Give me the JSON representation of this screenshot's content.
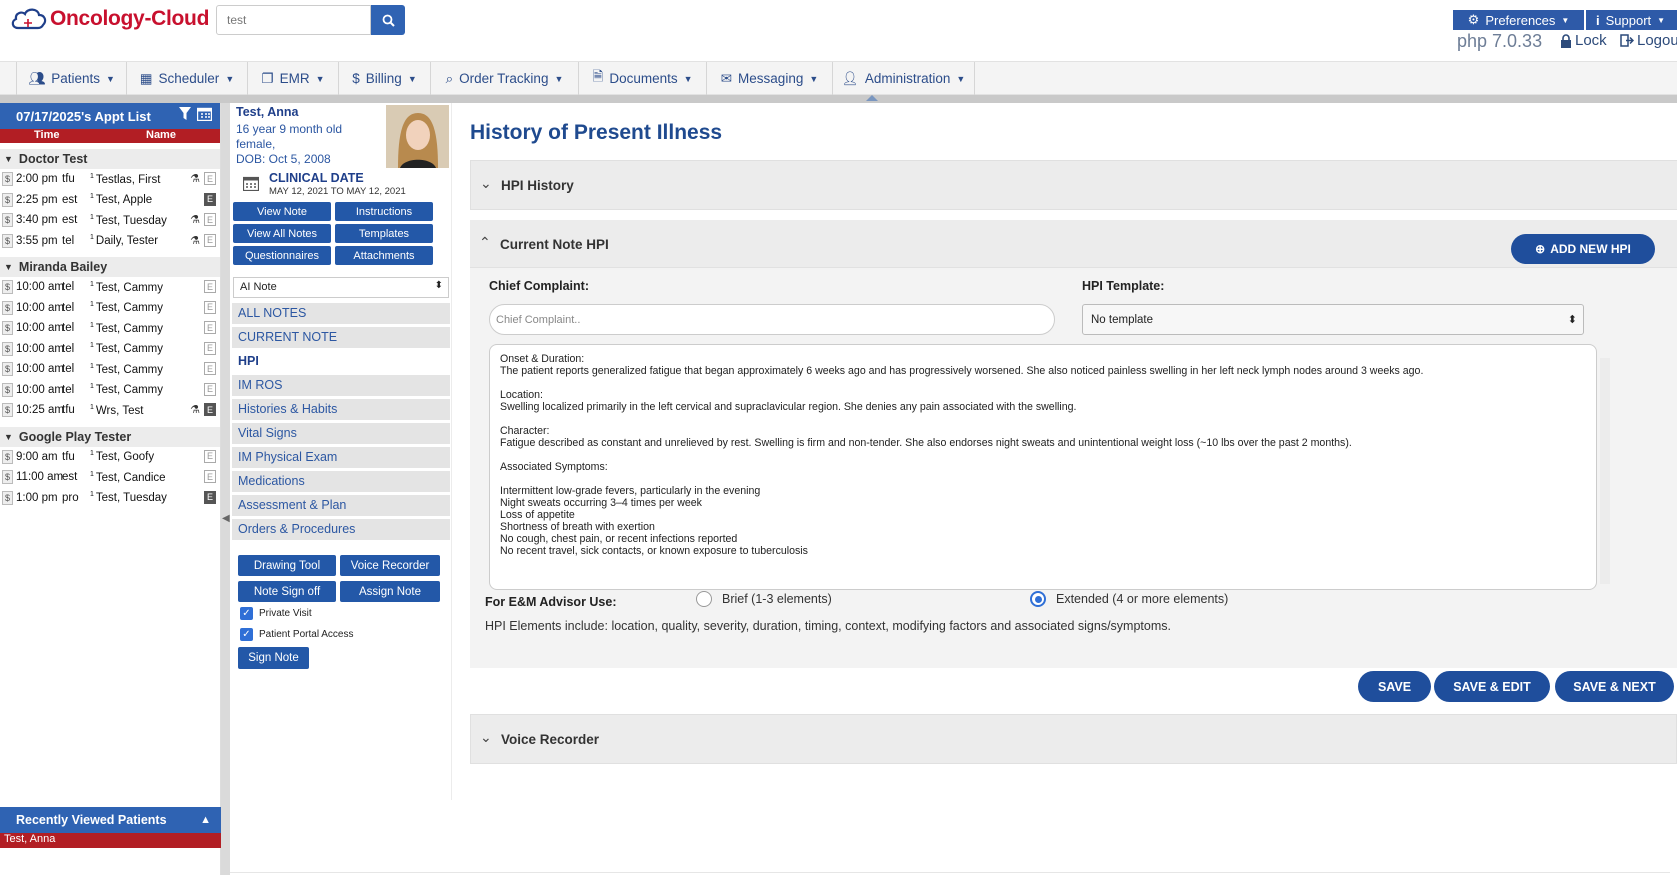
{
  "header": {
    "brand": "Oncology-Cloud",
    "search_value": "test",
    "preferences_label": "Preferences",
    "support_label": "Support",
    "php_version": "php 7.0.33",
    "lock_label": "Lock",
    "logout_label": "Logou"
  },
  "nav": {
    "items": [
      {
        "label": "Patients",
        "icon": "users-icon"
      },
      {
        "label": "Scheduler",
        "icon": "calendar-icon"
      },
      {
        "label": "EMR",
        "icon": "copy-icon"
      },
      {
        "label": "Billing",
        "icon": "dollar-icon"
      },
      {
        "label": "Order Tracking",
        "icon": "search-icon"
      },
      {
        "label": "Documents",
        "icon": "document-icon"
      },
      {
        "label": "Messaging",
        "icon": "envelope-icon"
      },
      {
        "label": "Administration",
        "icon": "user-icon"
      }
    ]
  },
  "appt_list": {
    "title": "07/17/2025's Appt List",
    "col_time": "Time",
    "col_name": "Name",
    "groups": [
      {
        "provider": "Doctor Test",
        "rows": [
          {
            "time": "2:00 pm",
            "type": "tfu",
            "num": "1",
            "name": "Testlas, First"
          },
          {
            "time": "2:25 pm",
            "type": "est",
            "num": "1",
            "name": "Test, Apple"
          },
          {
            "time": "3:40 pm",
            "type": "est",
            "num": "1",
            "name": "Test, Tuesday"
          },
          {
            "time": "3:55 pm",
            "type": "tel",
            "num": "1",
            "name": "Daily, Tester"
          }
        ]
      },
      {
        "provider": "Miranda Bailey",
        "rows": [
          {
            "time": "10:00 am",
            "type": "tel",
            "num": "1",
            "name": "Test, Cammy"
          },
          {
            "time": "10:00 am",
            "type": "tel",
            "num": "1",
            "name": "Test, Cammy"
          },
          {
            "time": "10:00 am",
            "type": "tel",
            "num": "1",
            "name": "Test, Cammy"
          },
          {
            "time": "10:00 am",
            "type": "tel",
            "num": "1",
            "name": "Test, Cammy"
          },
          {
            "time": "10:00 am",
            "type": "tel",
            "num": "1",
            "name": "Test, Cammy"
          },
          {
            "time": "10:00 am",
            "type": "tel",
            "num": "1",
            "name": "Test, Cammy"
          },
          {
            "time": "10:25 am",
            "type": "tfu",
            "num": "1",
            "name": "Wrs, Test"
          }
        ]
      },
      {
        "provider": "Google Play Tester",
        "rows": [
          {
            "time": "9:00 am",
            "type": "tfu",
            "num": "1",
            "name": "Test, Goofy"
          },
          {
            "time": "11:00 am",
            "type": "est",
            "num": "1",
            "name": "Test, Candice"
          },
          {
            "time": "1:00 pm",
            "type": "pro",
            "num": "1",
            "name": "Test, Tuesday"
          }
        ]
      }
    ],
    "recent_title": "Recently Viewed Patients",
    "recent_patient": "Test, Anna"
  },
  "patient": {
    "name": "Test, Anna",
    "age": "16 year 9 month old",
    "sex": "female,",
    "dob": "DOB: Oct 5, 2008",
    "clinical_title": "CLINICAL DATE",
    "clinical_range": "MAY 12, 2021 TO MAY 12, 2021",
    "buttons": [
      "View Note",
      "Instructions",
      "View All Notes",
      "Templates",
      "Questionnaires",
      "Attachments"
    ],
    "note_select": "AI Note",
    "side_nav": [
      "ALL NOTES",
      "CURRENT NOTE",
      "HPI",
      "IM ROS",
      "Histories & Habits",
      "Vital Signs",
      "IM Physical Exam",
      "Medications",
      "Assessment & Plan",
      "Orders & Procedures"
    ],
    "tools": [
      "Drawing Tool",
      "Voice Recorder",
      "Note Sign off",
      "Assign Note"
    ],
    "private_visit": "Private Visit",
    "portal_access": "Patient Portal Access",
    "sign_note": "Sign Note"
  },
  "main": {
    "title": "History of Present Illness",
    "hpi_history": "HPI History",
    "current_note_hpi": "Current Note HPI",
    "add_new_hpi": "ADD NEW HPI",
    "chief_label": "Chief Complaint:",
    "chief_placeholder": "Chief Complaint..",
    "template_label": "HPI Template:",
    "template_value": "No template",
    "hpi_text": "Onset & Duration:\nThe patient reports generalized fatigue that began approximately 6 weeks ago and has progressively worsened. She also noticed painless swelling in her left neck lymph nodes around 3 weeks ago.\n\nLocation:\nSwelling localized primarily in the left cervical and supraclavicular region. She denies any pain associated with the swelling.\n\nCharacter:\nFatigue described as constant and unrelieved by rest. Swelling is firm and non-tender. She also endorses night sweats and unintentional weight loss (~10 lbs over the past 2 months).\n\nAssociated Symptoms:\n\nIntermittent low-grade fevers, particularly in the evening\nNight sweats occurring 3–4 times per week\nLoss of appetite\nShortness of breath with exertion\nNo cough, chest pain, or recent infections reported\nNo recent travel, sick contacts, or known exposure to tuberculosis",
    "em_label": "For E&M Advisor Use:",
    "brief_label": "Brief (1-3 elements)",
    "extended_label": "Extended (4 or more elements)",
    "hpi_elements": "HPI Elements include: location, quality, severity, duration, timing, context, modifying factors and associated signs/symptoms.",
    "save": "SAVE",
    "save_edit": "SAVE & EDIT",
    "save_next": "SAVE & NEXT",
    "voice_recorder": "Voice Recorder"
  }
}
